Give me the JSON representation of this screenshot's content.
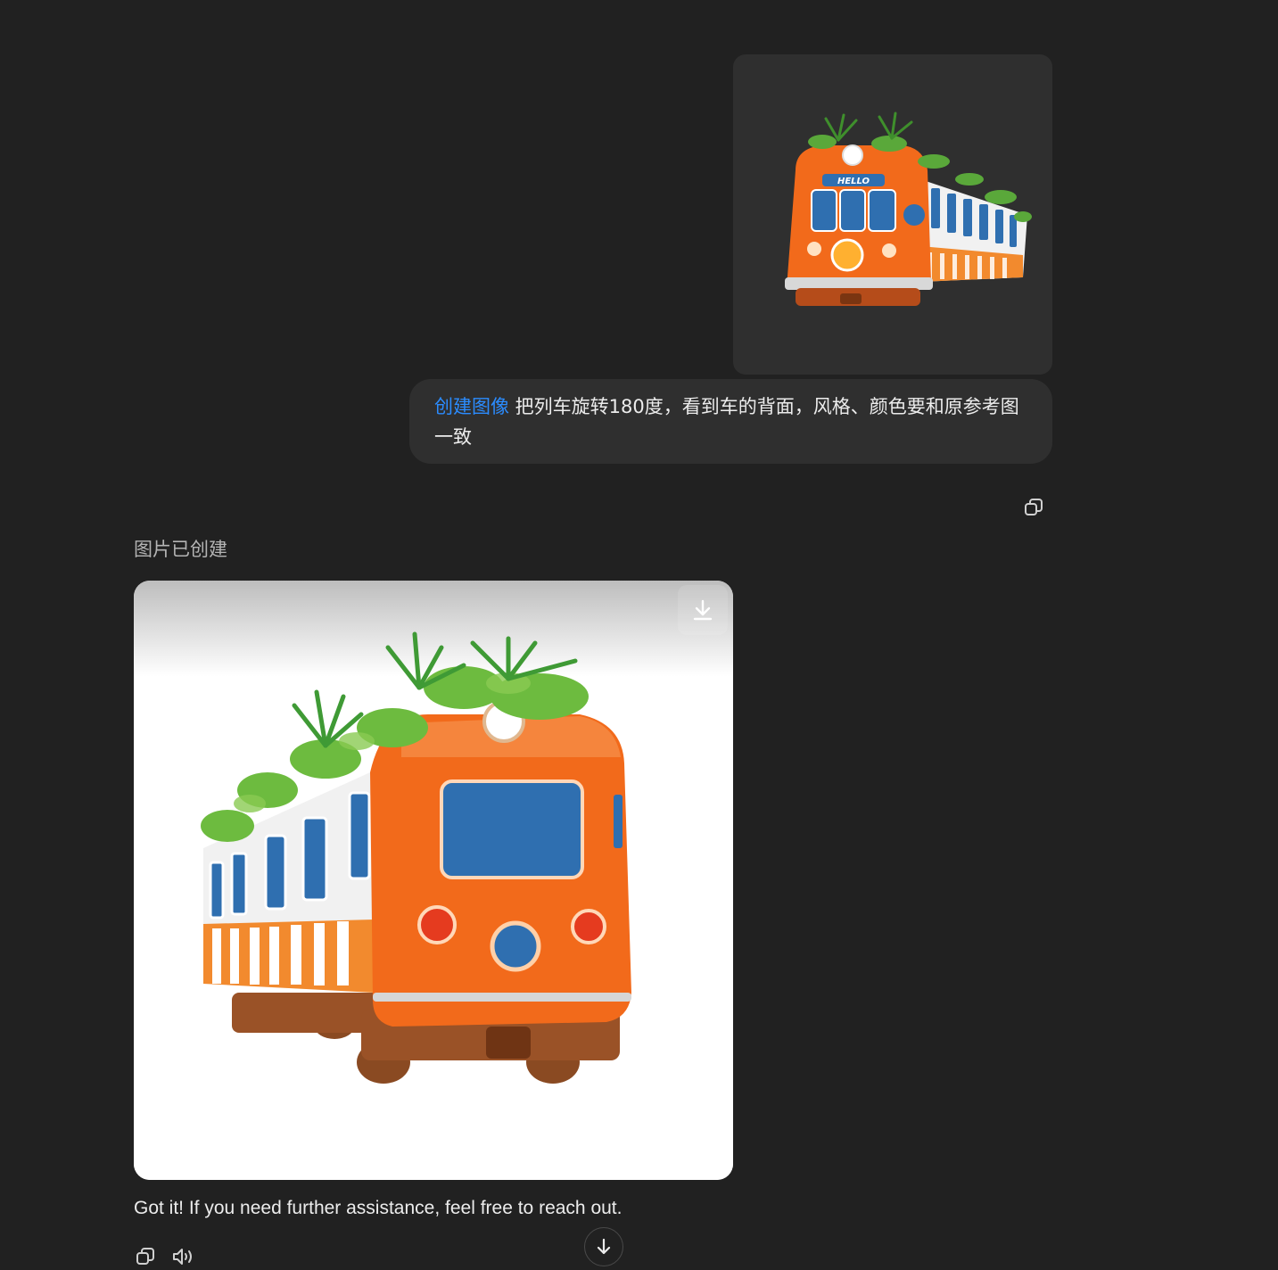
{
  "conversation": {
    "user_message": {
      "tag": "创建图像",
      "text": " 把列车旋转180度，看到车的背面，风格、颜色要和原参考图一致"
    },
    "uploaded_image": {
      "sign_text": "HELLO"
    },
    "assistant": {
      "status": "图片已创建",
      "reply": "Got it! If you need further assistance, feel free to reach out."
    }
  },
  "icons": {
    "copy_top": "copy-icon",
    "download": "download-icon",
    "copy_bottom": "copy-icon",
    "read_aloud": "speaker-icon",
    "scroll_down": "arrow-down-icon"
  },
  "colors": {
    "background": "#212121",
    "bubble": "#2f2f2f",
    "tag": "#2b8cff",
    "train_orange": "#f26a1b",
    "window_blue": "#2f6fb0"
  }
}
